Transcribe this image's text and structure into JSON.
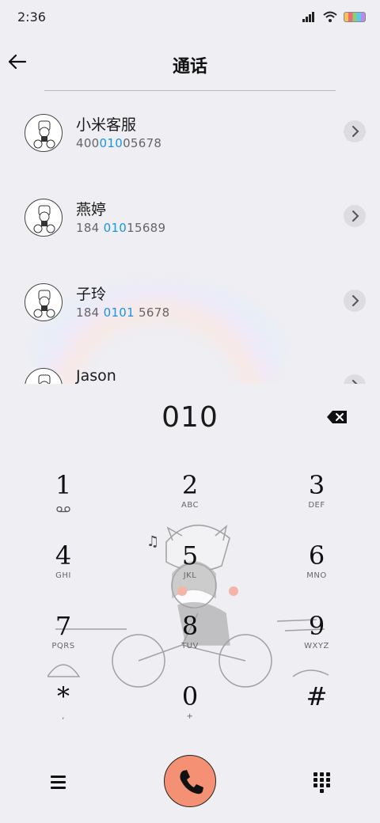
{
  "status_bar": {
    "time": "2:36"
  },
  "header": {
    "title": "通话"
  },
  "contacts": [
    {
      "name": "小米客服",
      "number_pre": "400",
      "number_match": "010",
      "number_post": "05678"
    },
    {
      "name": "燕婷",
      "number_pre": "184 ",
      "number_match": "010",
      "number_post": "15689"
    },
    {
      "name": "子玲",
      "number_pre": "184 ",
      "number_match": "0101",
      "number_post": " 5678"
    },
    {
      "name": "Jason",
      "number_pre": "",
      "number_match": "",
      "number_post": ""
    }
  ],
  "dialer": {
    "display": "010",
    "keys": [
      {
        "digit": "1",
        "letters": ""
      },
      {
        "digit": "2",
        "letters": "ABC"
      },
      {
        "digit": "3",
        "letters": "DEF"
      },
      {
        "digit": "4",
        "letters": "GHI"
      },
      {
        "digit": "5",
        "letters": "JKL"
      },
      {
        "digit": "6",
        "letters": "MNO"
      },
      {
        "digit": "7",
        "letters": "PQRS"
      },
      {
        "digit": "8",
        "letters": "TUV"
      },
      {
        "digit": "9",
        "letters": "WXYZ"
      },
      {
        "digit": "*",
        "letters": ","
      },
      {
        "digit": "0",
        "letters": "+"
      },
      {
        "digit": "#",
        "letters": ""
      }
    ]
  },
  "icons": {
    "back": "back-arrow-icon",
    "chevron": "chevron-right-icon",
    "delete": "backspace-icon",
    "voicemail": "voicemail-icon",
    "menu": "menu-icon",
    "call": "phone-icon",
    "keypad": "dialpad-icon"
  },
  "colors": {
    "highlight": "#1596e8",
    "call_button": "#f49073",
    "background": "#efeef3"
  }
}
